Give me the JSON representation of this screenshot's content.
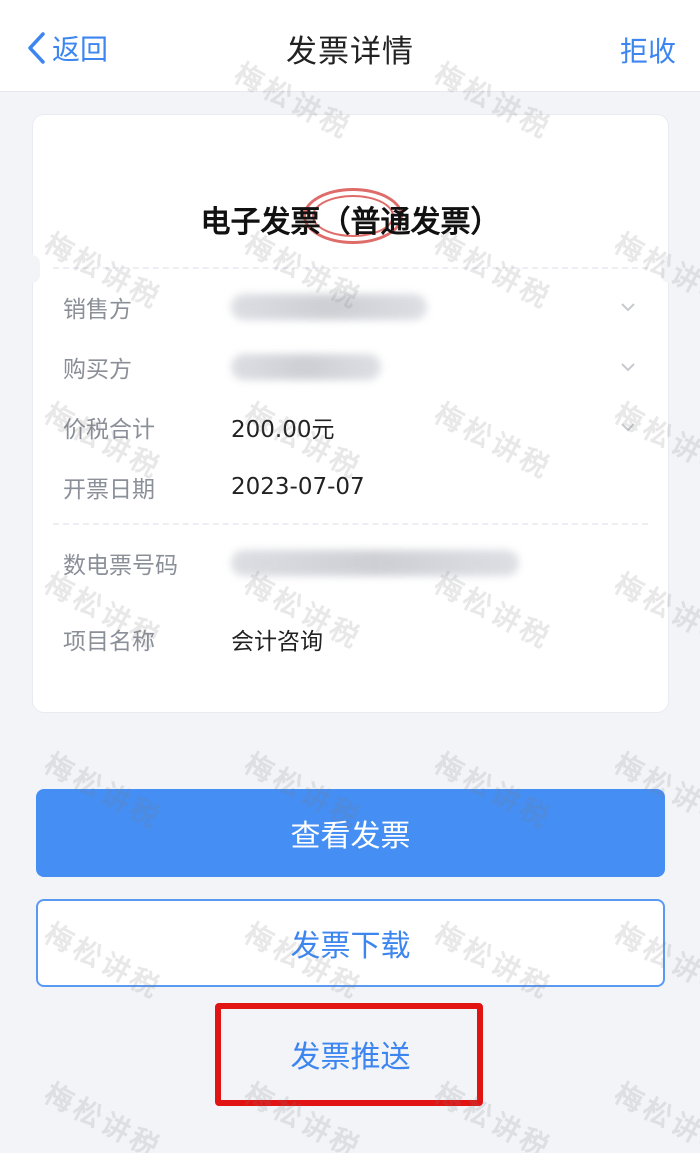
{
  "header": {
    "back_label": "返回",
    "title": "发票详情",
    "reject_label": "拒收"
  },
  "invoice": {
    "card_title": "电子发票（普通发票）",
    "fields": {
      "seller": {
        "label": "销售方",
        "value": ""
      },
      "buyer": {
        "label": "购买方",
        "value": ""
      },
      "total": {
        "label": "价税合计",
        "value": "200.00元"
      },
      "date": {
        "label": "开票日期",
        "value": "2023-07-07"
      },
      "number": {
        "label": "数电票号码",
        "value": ""
      },
      "item": {
        "label": "项目名称",
        "value": "会计咨询"
      }
    }
  },
  "actions": {
    "view_label": "查看发票",
    "download_label": "发票下载",
    "push_label": "发票推送"
  },
  "watermark_text": "梅松讲税",
  "colors": {
    "accent": "#3d86f0",
    "primary_button": "#448ef4",
    "highlight_border": "#e21313",
    "stamp": "#d9534f"
  }
}
